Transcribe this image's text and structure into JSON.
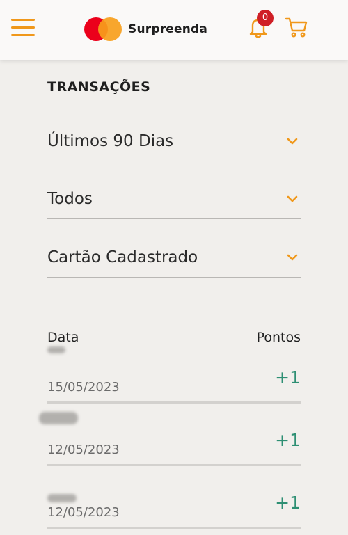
{
  "header": {
    "brand_text": "Surpreenda",
    "notification_count": "0",
    "accent_color": "#f0981b",
    "brand_colors": [
      "#eb001b",
      "#f79e1b"
    ]
  },
  "page": {
    "title": "TRANSAÇÕES"
  },
  "filters": [
    {
      "label": "Últimos 90 Dias"
    },
    {
      "label": "Todos"
    },
    {
      "label": "Cartão Cadastrado"
    }
  ],
  "table": {
    "columns": [
      "Data",
      "Pontos"
    ],
    "rows": [
      {
        "date": "15/05/2023",
        "points": "+1"
      },
      {
        "date": "12/05/2023",
        "points": "+1"
      },
      {
        "date": "12/05/2023",
        "points": "+1"
      }
    ]
  },
  "icons": [
    "menu-icon",
    "mastercard-logo",
    "bell-icon",
    "cart-icon",
    "chevron-down-icon"
  ]
}
